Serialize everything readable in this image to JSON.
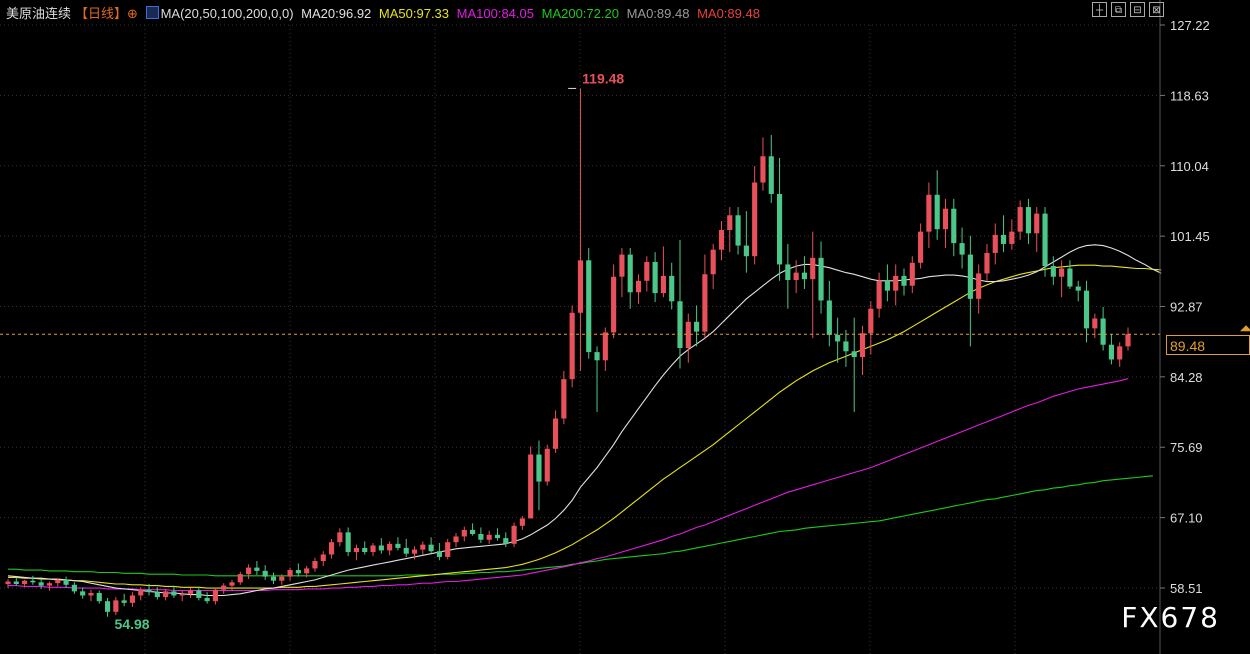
{
  "legend": {
    "symbol": "美原油连续",
    "period": "【日线】",
    "period_icon": "target-icon",
    "ma_icon": "ma-chart-icon",
    "ma_params": "MA(20,50,100,200,0,0)",
    "ma20": "MA20:96.92",
    "ma50": "MA50:97.33",
    "ma100": "MA100:84.05",
    "ma200": "MA200:72.20",
    "ma0a": "MA0:89.48",
    "ma0b": "MA0:89.48"
  },
  "colors": {
    "up": "#e8505b",
    "down": "#4cc78a",
    "ma20": "#e0e0e0",
    "ma50": "#e6e31c",
    "ma100": "#e01ee0",
    "ma200": "#1ec81e",
    "ma0a": "#9a9a9a",
    "ma0b": "#e84040",
    "symbol": "#dddddd",
    "period": "#e06a20",
    "last_price": "#e0a030",
    "grid": "#333333",
    "high_label": "#e8505b",
    "low_label": "#4cc78a"
  },
  "toolbar": {
    "b1": "┼",
    "b2": "⧉",
    "b3": "⊟",
    "b4": "⊠"
  },
  "watermark": "FX678",
  "last_price_label": "89.48",
  "chart_data": {
    "type": "candlestick",
    "y_ticks": [
      "127.22",
      "118.63",
      "110.04",
      "101.45",
      "92.87",
      "84.28",
      "75.69",
      "67.10",
      "58.51"
    ],
    "ylim": [
      56.5,
      127.22
    ],
    "last_price": 89.48,
    "annotations": [
      {
        "text": "119.48",
        "value": 119.48,
        "index": 68
      },
      {
        "text": "54.98",
        "value": 54.98,
        "index": 12
      }
    ],
    "candles": [
      [
        59.0,
        59.6,
        58.5,
        59.3
      ],
      [
        59.3,
        59.8,
        58.8,
        59.0
      ],
      [
        59.0,
        59.5,
        58.6,
        59.4
      ],
      [
        59.4,
        60.0,
        58.9,
        59.2
      ],
      [
        59.2,
        59.6,
        58.4,
        58.8
      ],
      [
        58.8,
        59.3,
        58.2,
        59.1
      ],
      [
        59.1,
        59.7,
        58.7,
        59.5
      ],
      [
        59.5,
        59.9,
        58.5,
        58.9
      ],
      [
        58.9,
        59.2,
        57.8,
        58.1
      ],
      [
        58.1,
        58.6,
        57.2,
        57.6
      ],
      [
        57.6,
        58.3,
        56.9,
        57.9
      ],
      [
        57.9,
        58.2,
        56.6,
        56.9
      ],
      [
        56.9,
        57.3,
        55.0,
        55.6
      ],
      [
        55.6,
        57.4,
        55.2,
        57.0
      ],
      [
        57.0,
        57.8,
        56.3,
        56.7
      ],
      [
        56.7,
        58.0,
        56.2,
        57.6
      ],
      [
        57.6,
        58.6,
        57.0,
        58.3
      ],
      [
        58.3,
        59.0,
        57.6,
        58.0
      ],
      [
        58.0,
        58.6,
        57.1,
        57.4
      ],
      [
        57.4,
        58.4,
        57.0,
        58.1
      ],
      [
        58.1,
        58.8,
        57.3,
        57.6
      ],
      [
        57.6,
        58.2,
        56.9,
        57.8
      ],
      [
        57.8,
        58.5,
        57.3,
        58.2
      ],
      [
        58.2,
        58.7,
        57.0,
        57.3
      ],
      [
        57.3,
        58.0,
        56.6,
        56.9
      ],
      [
        56.9,
        58.6,
        56.5,
        58.3
      ],
      [
        58.3,
        59.1,
        57.8,
        58.8
      ],
      [
        58.8,
        59.5,
        58.2,
        59.2
      ],
      [
        59.2,
        60.5,
        58.9,
        60.2
      ],
      [
        60.2,
        61.4,
        59.6,
        61.0
      ],
      [
        61.0,
        61.8,
        60.1,
        60.6
      ],
      [
        60.6,
        61.3,
        59.5,
        59.9
      ],
      [
        59.9,
        60.4,
        59.0,
        59.4
      ],
      [
        59.4,
        60.2,
        58.9,
        59.9
      ],
      [
        59.9,
        61.0,
        59.4,
        60.7
      ],
      [
        60.7,
        61.5,
        59.9,
        60.3
      ],
      [
        60.3,
        61.2,
        59.8,
        60.9
      ],
      [
        60.9,
        62.2,
        60.5,
        61.8
      ],
      [
        61.8,
        63.0,
        61.2,
        62.6
      ],
      [
        62.6,
        64.5,
        62.1,
        64.1
      ],
      [
        64.1,
        65.8,
        63.6,
        65.3
      ],
      [
        65.3,
        65.9,
        62.4,
        62.9
      ],
      [
        62.9,
        63.8,
        61.9,
        63.4
      ],
      [
        63.4,
        64.2,
        62.6,
        62.9
      ],
      [
        62.9,
        64.0,
        62.4,
        63.7
      ],
      [
        63.7,
        64.6,
        62.7,
        63.1
      ],
      [
        63.1,
        64.2,
        62.5,
        63.9
      ],
      [
        63.9,
        64.7,
        63.1,
        63.4
      ],
      [
        63.4,
        64.5,
        62.3,
        62.7
      ],
      [
        62.7,
        63.6,
        62.0,
        63.2
      ],
      [
        63.2,
        64.2,
        62.6,
        63.8
      ],
      [
        63.8,
        64.7,
        62.8,
        63.0
      ],
      [
        63.0,
        64.0,
        61.9,
        62.3
      ],
      [
        62.3,
        64.5,
        62.0,
        64.1
      ],
      [
        64.1,
        65.2,
        63.5,
        64.8
      ],
      [
        64.8,
        66.0,
        64.2,
        65.6
      ],
      [
        65.6,
        66.4,
        64.9,
        65.1
      ],
      [
        65.1,
        65.9,
        64.0,
        64.4
      ],
      [
        64.4,
        65.5,
        63.9,
        65.0
      ],
      [
        65.0,
        65.8,
        64.3,
        64.6
      ],
      [
        64.6,
        65.3,
        63.5,
        63.9
      ],
      [
        63.9,
        66.5,
        63.5,
        66.1
      ],
      [
        66.1,
        67.3,
        65.6,
        67.0
      ],
      [
        67.0,
        75.8,
        69.8,
        74.8
      ],
      [
        74.8,
        76.5,
        68.0,
        71.5
      ],
      [
        71.5,
        76.0,
        71.0,
        75.5
      ],
      [
        75.5,
        80.2,
        75.0,
        79.2
      ],
      [
        79.2,
        85.0,
        78.5,
        84.0
      ],
      [
        84.0,
        93.0,
        83.0,
        92.1
      ],
      [
        92.1,
        119.48,
        85.0,
        98.5
      ],
      [
        98.5,
        100.0,
        86.5,
        87.3
      ],
      [
        87.3,
        88.0,
        80.0,
        86.3
      ],
      [
        86.3,
        90.3,
        85.0,
        89.7
      ],
      [
        89.7,
        98.0,
        89.0,
        96.5
      ],
      [
        96.5,
        100.0,
        94.0,
        99.2
      ],
      [
        99.2,
        100.0,
        92.6,
        94.6
      ],
      [
        94.6,
        96.8,
        93.2,
        96.0
      ],
      [
        96.0,
        99.0,
        94.7,
        98.3
      ],
      [
        98.3,
        99.5,
        93.4,
        94.5
      ],
      [
        94.5,
        100.2,
        94.0,
        96.6
      ],
      [
        96.6,
        98.2,
        92.5,
        93.5
      ],
      [
        93.5,
        101.0,
        85.3,
        87.8
      ],
      [
        87.8,
        92.0,
        86.0,
        91.0
      ],
      [
        91.0,
        93.0,
        88.0,
        89.8
      ],
      [
        89.8,
        99.2,
        89.0,
        96.8
      ],
      [
        96.8,
        100.5,
        95.0,
        99.8
      ],
      [
        99.8,
        103.3,
        98.5,
        102.2
      ],
      [
        102.2,
        105.0,
        99.5,
        104.0
      ],
      [
        104.0,
        105.0,
        99.2,
        100.3
      ],
      [
        100.3,
        104.5,
        97.0,
        99.0
      ],
      [
        99.0,
        110.0,
        98.0,
        108.0
      ],
      [
        108.0,
        113.5,
        107.0,
        111.2
      ],
      [
        111.2,
        113.8,
        105.5,
        106.6
      ],
      [
        106.6,
        111.0,
        96.0,
        98.0
      ],
      [
        98.0,
        100.5,
        92.6,
        96.1
      ],
      [
        96.1,
        98.5,
        94.5,
        97.0
      ],
      [
        97.0,
        99.0,
        95.0,
        96.2
      ],
      [
        96.2,
        102.0,
        89.0,
        98.8
      ],
      [
        98.8,
        100.8,
        92.0,
        93.6
      ],
      [
        93.6,
        96.0,
        88.0,
        89.4
      ],
      [
        89.4,
        91.5,
        86.0,
        88.6
      ],
      [
        88.6,
        90.0,
        85.5,
        87.4
      ],
      [
        87.4,
        91.5,
        80.0,
        86.7
      ],
      [
        86.7,
        90.5,
        84.5,
        89.6
      ],
      [
        89.6,
        93.5,
        87.0,
        92.6
      ],
      [
        92.6,
        97.0,
        91.5,
        96.0
      ],
      [
        96.0,
        98.0,
        93.5,
        94.8
      ],
      [
        94.8,
        98.0,
        93.0,
        96.6
      ],
      [
        96.6,
        97.5,
        94.2,
        95.4
      ],
      [
        95.4,
        99.0,
        94.5,
        98.2
      ],
      [
        98.2,
        103.0,
        97.5,
        102.0
      ],
      [
        102.0,
        108.0,
        100.0,
        106.5
      ],
      [
        106.5,
        109.5,
        101.0,
        102.3
      ],
      [
        102.3,
        106.0,
        100.0,
        104.8
      ],
      [
        104.8,
        106.0,
        99.0,
        100.6
      ],
      [
        100.6,
        102.5,
        97.5,
        99.2
      ],
      [
        99.2,
        101.5,
        88.0,
        93.8
      ],
      [
        93.8,
        98.0,
        92.0,
        96.9
      ],
      [
        96.9,
        100.5,
        96.0,
        99.4
      ],
      [
        99.4,
        103.0,
        98.0,
        101.6
      ],
      [
        101.6,
        104.0,
        99.5,
        100.5
      ],
      [
        100.5,
        103.5,
        99.8,
        102.0
      ],
      [
        102.0,
        105.8,
        101.0,
        105.0
      ],
      [
        105.0,
        106.0,
        100.5,
        101.8
      ],
      [
        101.8,
        105.0,
        99.5,
        104.2
      ],
      [
        104.2,
        105.0,
        96.5,
        97.8
      ],
      [
        97.8,
        99.0,
        95.5,
        96.5
      ],
      [
        96.5,
        98.5,
        94.0,
        97.5
      ],
      [
        97.5,
        98.5,
        95.0,
        95.3
      ],
      [
        95.3,
        96.0,
        93.5,
        94.8
      ],
      [
        94.8,
        96.0,
        88.5,
        90.2
      ],
      [
        90.2,
        92.0,
        89.0,
        91.4
      ],
      [
        91.4,
        92.8,
        87.5,
        88.2
      ],
      [
        88.2,
        89.5,
        85.8,
        86.4
      ],
      [
        86.4,
        88.5,
        85.5,
        88.0
      ],
      [
        88.0,
        90.3,
        87.5,
        89.48
      ]
    ],
    "ma20": [
      60.0,
      59.9,
      59.8,
      59.7,
      59.7,
      59.6,
      59.6,
      59.5,
      59.4,
      59.3,
      59.1,
      58.9,
      58.7,
      58.5,
      58.4,
      58.3,
      58.2,
      58.1,
      58.0,
      57.9,
      57.9,
      57.8,
      57.7,
      57.7,
      57.6,
      57.6,
      57.6,
      57.7,
      57.8,
      58.0,
      58.2,
      58.4,
      58.5,
      58.7,
      58.9,
      59.1,
      59.3,
      59.5,
      59.8,
      60.1,
      60.4,
      60.7,
      60.9,
      61.1,
      61.3,
      61.5,
      61.7,
      61.9,
      62.1,
      62.3,
      62.5,
      62.7,
      62.9,
      63.1,
      63.3,
      63.4,
      63.5,
      63.6,
      63.7,
      63.8,
      63.9,
      64.2,
      64.5,
      65.0,
      65.6,
      66.2,
      67.0,
      68.0,
      69.2,
      70.8,
      72.0,
      73.2,
      74.6,
      76.0,
      77.6,
      79.0,
      80.4,
      81.8,
      83.2,
      84.5,
      85.7,
      86.8,
      87.6,
      88.3,
      89.0,
      89.8,
      90.8,
      91.8,
      92.8,
      93.8,
      94.6,
      95.4,
      96.2,
      96.9,
      97.4,
      97.8,
      98.0,
      98.0,
      97.8,
      97.6,
      97.3,
      97.0,
      96.8,
      96.5,
      96.2,
      96.0,
      96.0,
      96.0,
      96.1,
      96.2,
      96.3,
      96.5,
      96.6,
      96.7,
      96.7,
      96.6,
      96.4,
      96.1,
      95.9,
      95.9,
      96.0,
      96.2,
      96.4,
      96.7,
      97.1,
      97.7,
      98.3,
      98.9,
      99.5,
      100.0,
      100.3,
      100.4,
      100.3,
      100.0,
      99.6,
      99.1,
      98.5,
      98.0,
      97.4,
      96.92
    ],
    "ma50": [
      59.8,
      59.8,
      59.7,
      59.7,
      59.6,
      59.6,
      59.5,
      59.5,
      59.4,
      59.4,
      59.3,
      59.2,
      59.1,
      59.0,
      59.0,
      58.9,
      58.9,
      58.8,
      58.8,
      58.7,
      58.7,
      58.6,
      58.6,
      58.6,
      58.5,
      58.5,
      58.5,
      58.5,
      58.5,
      58.5,
      58.5,
      58.5,
      58.5,
      58.6,
      58.6,
      58.6,
      58.7,
      58.7,
      58.8,
      58.9,
      59.0,
      59.1,
      59.2,
      59.3,
      59.4,
      59.5,
      59.6,
      59.7,
      59.8,
      59.9,
      60.0,
      60.1,
      60.2,
      60.3,
      60.4,
      60.5,
      60.6,
      60.7,
      60.8,
      60.9,
      61.0,
      61.2,
      61.4,
      61.7,
      62.0,
      62.4,
      62.8,
      63.3,
      63.8,
      64.4,
      65.0,
      65.6,
      66.3,
      67.0,
      67.8,
      68.6,
      69.4,
      70.2,
      71.0,
      71.8,
      72.5,
      73.2,
      73.9,
      74.6,
      75.3,
      76.0,
      76.8,
      77.6,
      78.4,
      79.2,
      80.0,
      80.8,
      81.6,
      82.4,
      83.1,
      83.8,
      84.4,
      85.0,
      85.5,
      86.0,
      86.4,
      86.8,
      87.2,
      87.6,
      88.0,
      88.4,
      88.8,
      89.3,
      89.8,
      90.4,
      91.0,
      91.6,
      92.2,
      92.8,
      93.4,
      94.0,
      94.6,
      95.1,
      95.5,
      95.9,
      96.2,
      96.5,
      96.8,
      97.0,
      97.2,
      97.4,
      97.6,
      97.7,
      97.8,
      97.9,
      97.9,
      97.9,
      97.8,
      97.8,
      97.7,
      97.6,
      97.5,
      97.5,
      97.4,
      97.33
    ],
    "ma100": [
      58.8,
      58.8,
      58.7,
      58.7,
      58.7,
      58.6,
      58.6,
      58.6,
      58.5,
      58.5,
      58.5,
      58.5,
      58.4,
      58.4,
      58.4,
      58.4,
      58.3,
      58.3,
      58.3,
      58.3,
      58.2,
      58.2,
      58.2,
      58.2,
      58.2,
      58.2,
      58.2,
      58.2,
      58.2,
      58.2,
      58.2,
      58.2,
      58.3,
      58.3,
      58.3,
      58.3,
      58.4,
      58.4,
      58.4,
      58.5,
      58.5,
      58.6,
      58.6,
      58.7,
      58.7,
      58.8,
      58.8,
      58.9,
      58.9,
      59.0,
      59.1,
      59.1,
      59.2,
      59.3,
      59.3,
      59.4,
      59.5,
      59.6,
      59.7,
      59.8,
      59.9,
      60.0,
      60.1,
      60.3,
      60.5,
      60.7,
      60.9,
      61.1,
      61.3,
      61.6,
      61.8,
      62.1,
      62.3,
      62.6,
      62.9,
      63.2,
      63.5,
      63.8,
      64.1,
      64.4,
      64.8,
      65.1,
      65.5,
      65.9,
      66.2,
      66.6,
      67.0,
      67.4,
      67.8,
      68.2,
      68.6,
      69.0,
      69.4,
      69.8,
      70.2,
      70.5,
      70.8,
      71.1,
      71.4,
      71.7,
      72.0,
      72.3,
      72.6,
      72.9,
      73.2,
      73.6,
      74.0,
      74.4,
      74.8,
      75.2,
      75.6,
      76.0,
      76.4,
      76.8,
      77.2,
      77.6,
      78.0,
      78.4,
      78.8,
      79.2,
      79.6,
      80.0,
      80.4,
      80.8,
      81.1,
      81.5,
      81.9,
      82.2,
      82.5,
      82.8,
      83.0,
      83.2,
      83.4,
      83.6,
      83.8,
      84.05
    ],
    "ma200": [
      60.8,
      60.8,
      60.7,
      60.7,
      60.7,
      60.6,
      60.6,
      60.6,
      60.5,
      60.5,
      60.5,
      60.4,
      60.4,
      60.4,
      60.3,
      60.3,
      60.3,
      60.2,
      60.2,
      60.2,
      60.2,
      60.1,
      60.1,
      60.1,
      60.1,
      60.0,
      60.0,
      60.0,
      60.0,
      60.0,
      60.0,
      60.0,
      60.0,
      60.0,
      60.0,
      60.0,
      60.0,
      60.0,
      60.0,
      60.0,
      60.0,
      60.0,
      60.0,
      60.0,
      60.0,
      60.0,
      60.0,
      60.0,
      60.1,
      60.1,
      60.1,
      60.1,
      60.2,
      60.2,
      60.2,
      60.3,
      60.3,
      60.4,
      60.4,
      60.5,
      60.5,
      60.6,
      60.7,
      60.8,
      60.9,
      61.0,
      61.1,
      61.2,
      61.4,
      61.5,
      61.7,
      61.8,
      62.0,
      62.1,
      62.2,
      62.3,
      62.4,
      62.5,
      62.6,
      62.7,
      62.9,
      63.0,
      63.2,
      63.4,
      63.6,
      63.8,
      64.0,
      64.2,
      64.4,
      64.6,
      64.8,
      65.0,
      65.2,
      65.4,
      65.5,
      65.6,
      65.8,
      65.9,
      66.0,
      66.1,
      66.2,
      66.3,
      66.4,
      66.5,
      66.6,
      66.7,
      66.9,
      67.1,
      67.3,
      67.5,
      67.7,
      67.9,
      68.1,
      68.3,
      68.5,
      68.7,
      68.9,
      69.1,
      69.3,
      69.4,
      69.6,
      69.8,
      70.0,
      70.2,
      70.4,
      70.5,
      70.7,
      70.8,
      71.0,
      71.1,
      71.3,
      71.4,
      71.6,
      71.7,
      71.8,
      71.9,
      72.0,
      72.1,
      72.2
    ]
  }
}
